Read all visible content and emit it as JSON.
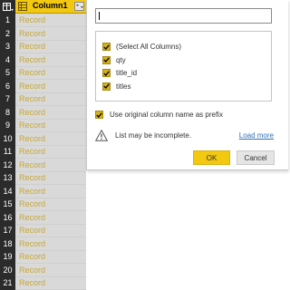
{
  "grid": {
    "column_title": "Column1",
    "rows": [
      {
        "num": "1",
        "value": "Record"
      },
      {
        "num": "2",
        "value": "Record"
      },
      {
        "num": "3",
        "value": "Record"
      },
      {
        "num": "4",
        "value": "Record"
      },
      {
        "num": "5",
        "value": "Record"
      },
      {
        "num": "6",
        "value": "Record"
      },
      {
        "num": "7",
        "value": "Record"
      },
      {
        "num": "8",
        "value": "Record"
      },
      {
        "num": "9",
        "value": "Record"
      },
      {
        "num": "10",
        "value": "Record"
      },
      {
        "num": "11",
        "value": "Record"
      },
      {
        "num": "12",
        "value": "Record"
      },
      {
        "num": "13",
        "value": "Record"
      },
      {
        "num": "14",
        "value": "Record"
      },
      {
        "num": "15",
        "value": "Record"
      },
      {
        "num": "16",
        "value": "Record"
      },
      {
        "num": "17",
        "value": "Record"
      },
      {
        "num": "18",
        "value": "Record"
      },
      {
        "num": "19",
        "value": "Record"
      },
      {
        "num": "20",
        "value": "Record"
      },
      {
        "num": "21",
        "value": "Record"
      }
    ]
  },
  "panel": {
    "search_value": "",
    "columns": [
      {
        "label": "(Select All Columns)",
        "checked": true
      },
      {
        "label": "qty",
        "checked": true
      },
      {
        "label": "title_id",
        "checked": true
      },
      {
        "label": "titles",
        "checked": true
      }
    ],
    "prefix_label": "Use original column name as prefix",
    "prefix_checked": true,
    "warning_text": "List may be incomplete.",
    "load_more_label": "Load more",
    "ok_label": "OK",
    "cancel_label": "Cancel"
  },
  "colors": {
    "accent": "#f2c811",
    "row_header_bg": "#2b2b2b",
    "record_text": "#c6a83a",
    "link": "#2f6fb3"
  },
  "icons": {
    "corner": "table-icon",
    "column_type": "record-type-icon",
    "expand": "expand-columns-icon",
    "warning": "warning-icon",
    "checkbox": "check-icon"
  }
}
